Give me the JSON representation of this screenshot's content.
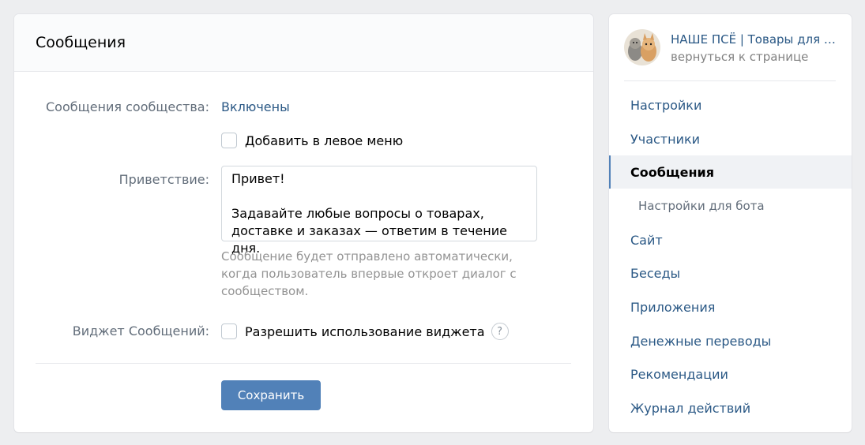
{
  "main": {
    "title": "Сообщения",
    "messages_label": "Сообщения сообщества:",
    "messages_status": "Включены",
    "add_left_menu_label": "Добавить в левое меню",
    "greeting_label": "Приветствие:",
    "greeting_text": "Привет!\n\nЗадавайте любые вопросы о товарах, доставке и заказах — ответим в течение дня.",
    "greeting_hint": "Сообщение будет отправлено автоматически, когда пользователь впервые откроет диалог с сообществом.",
    "widget_label": "Виджет Сообщений:",
    "widget_checkbox_label": "Разрешить использование виджета",
    "help_symbol": "?",
    "save_label": "Сохранить"
  },
  "sidebar": {
    "community_name": "НАШЕ ПСЁ | Товары для собак",
    "back_link": "вернуться к странице",
    "items": [
      {
        "label": "Настройки"
      },
      {
        "label": "Участники"
      },
      {
        "label": "Сообщения"
      },
      {
        "label": "Настройки для бота"
      },
      {
        "label": "Сайт"
      },
      {
        "label": "Беседы"
      },
      {
        "label": "Приложения"
      },
      {
        "label": "Денежные переводы"
      },
      {
        "label": "Рекомендации"
      },
      {
        "label": "Журнал действий"
      }
    ]
  },
  "colors": {
    "link": "#2a5885",
    "button": "#5181b8",
    "page_bg": "#edeef0"
  }
}
